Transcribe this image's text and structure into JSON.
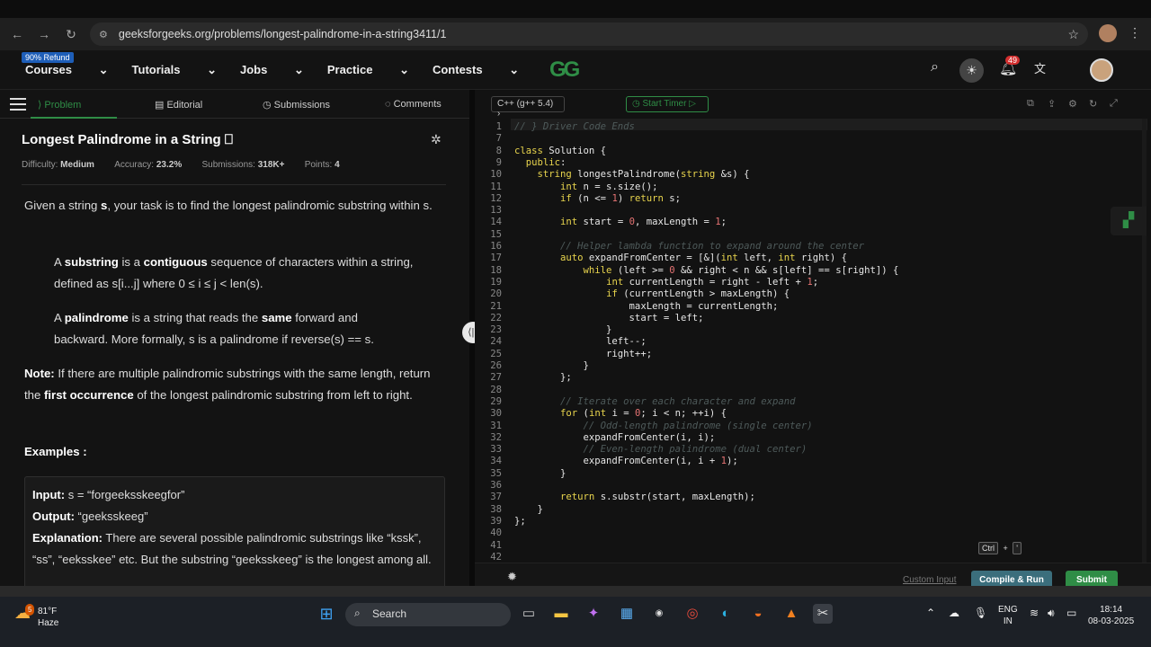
{
  "browser": {
    "url": "geeksforgeeks.org/problems/longest-palindrome-in-a-string3411/1"
  },
  "nav": {
    "refund": "90% Refund",
    "items": [
      "Courses",
      "Tutorials",
      "Jobs",
      "Practice",
      "Contests"
    ],
    "logo": "GG",
    "notifications": "49"
  },
  "tabs": [
    "Problem",
    "Editorial",
    "Submissions",
    "Comments"
  ],
  "problem": {
    "title": "Longest Palindrome in a String",
    "difficulty_label": "Difficulty:",
    "difficulty": "Medium",
    "accuracy_label": "Accuracy:",
    "accuracy": "23.2%",
    "submissions_label": "Submissions:",
    "submissions": "318K+",
    "points_label": "Points:",
    "points": "4",
    "p1a": "Given a string ",
    "p1b": "s",
    "p1c": ", your task is to find the longest palindromic substring within s.",
    "p2a": "A ",
    "p2b": "substring",
    "p2c": " is a ",
    "p2d": "contiguous",
    "p2e": " sequence of characters within a string, defined as s[i...j] where 0 ≤ i ≤ j < len(s).",
    "p3a": "A ",
    "p3b": "palindrome",
    "p3c": " is a string that reads the ",
    "p3d": "same",
    "p3e": " forward and backward. More formally, s is a palindrome if reverse(s) == s.",
    "p4a": "Note:",
    "p4b": " If there are multiple palindromic substrings with the same length, return the ",
    "p4c": "first occurrence",
    "p4d": " of the longest palindromic substring from left to right.",
    "examples": "Examples :",
    "ex_input_label": "Input:",
    "ex_input": " s = “forgeeksskeegfor”",
    "ex_output_label": "Output:",
    "ex_output": " “geeksskeeg”",
    "ex_expl_label": "Explanation:",
    "ex_expl": " There are several possible palindromic substrings like “kssk”, “ss”, “eeksskee” etc. But the substring “geeksskeeg” is the longest among all."
  },
  "editor": {
    "language": "C++ (g++ 5.4)",
    "timer": "Start Timer",
    "custom_input": "Custom Input",
    "compile": "Compile & Run",
    "submit": "Submit",
    "ctrl": "Ctrl",
    "plus": "+",
    "quote": "'"
  },
  "code": [
    {
      "n": "1",
      "t": "// } Driver Code Ends",
      "c": "cm"
    },
    {
      "n": "7",
      "t": ""
    },
    {
      "n": "8",
      "t": "class Solution {"
    },
    {
      "n": "9",
      "t": "  public:"
    },
    {
      "n": "10",
      "t": "    string longestPalindrome(string &s) {"
    },
    {
      "n": "11",
      "t": "        int n = s.size();"
    },
    {
      "n": "12",
      "t": "        if (n <= 1) return s;"
    },
    {
      "n": "13",
      "t": ""
    },
    {
      "n": "14",
      "t": "        int start = 0, maxLength = 1;"
    },
    {
      "n": "15",
      "t": ""
    },
    {
      "n": "16",
      "t": "        // Helper lambda function to expand around the center",
      "c": "cm"
    },
    {
      "n": "17",
      "t": "        auto expandFromCenter = [&](int left, int right) {"
    },
    {
      "n": "18",
      "t": "            while (left >= 0 && right < n && s[left] == s[right]) {"
    },
    {
      "n": "19",
      "t": "                int currentLength = right - left + 1;"
    },
    {
      "n": "20",
      "t": "                if (currentLength > maxLength) {"
    },
    {
      "n": "21",
      "t": "                    maxLength = currentLength;"
    },
    {
      "n": "22",
      "t": "                    start = left;"
    },
    {
      "n": "23",
      "t": "                }"
    },
    {
      "n": "24",
      "t": "                left--;"
    },
    {
      "n": "25",
      "t": "                right++;"
    },
    {
      "n": "26",
      "t": "            }"
    },
    {
      "n": "27",
      "t": "        };"
    },
    {
      "n": "28",
      "t": ""
    },
    {
      "n": "29",
      "t": "        // Iterate over each character and expand",
      "c": "cm"
    },
    {
      "n": "30",
      "t": "        for (int i = 0; i < n; ++i) {"
    },
    {
      "n": "31",
      "t": "            // Odd-length palindrome (single center)",
      "c": "cm"
    },
    {
      "n": "32",
      "t": "            expandFromCenter(i, i);"
    },
    {
      "n": "33",
      "t": "            // Even-length palindrome (dual center)",
      "c": "cm"
    },
    {
      "n": "34",
      "t": "            expandFromCenter(i, i + 1);"
    },
    {
      "n": "35",
      "t": "        }"
    },
    {
      "n": "36",
      "t": ""
    },
    {
      "n": "37",
      "t": "        return s.substr(start, maxLength);"
    },
    {
      "n": "38",
      "t": "    }"
    },
    {
      "n": "39",
      "t": "};"
    },
    {
      "n": "40",
      "t": ""
    },
    {
      "n": "41",
      "t": ""
    },
    {
      "n": "42",
      "t": ""
    }
  ],
  "taskbar": {
    "temp": "81°F",
    "weather": "Haze",
    "weather_badge": "5",
    "search": "Search",
    "lang1": "ENG",
    "lang2": "IN",
    "time": "18:14",
    "date": "08-03-2025"
  }
}
